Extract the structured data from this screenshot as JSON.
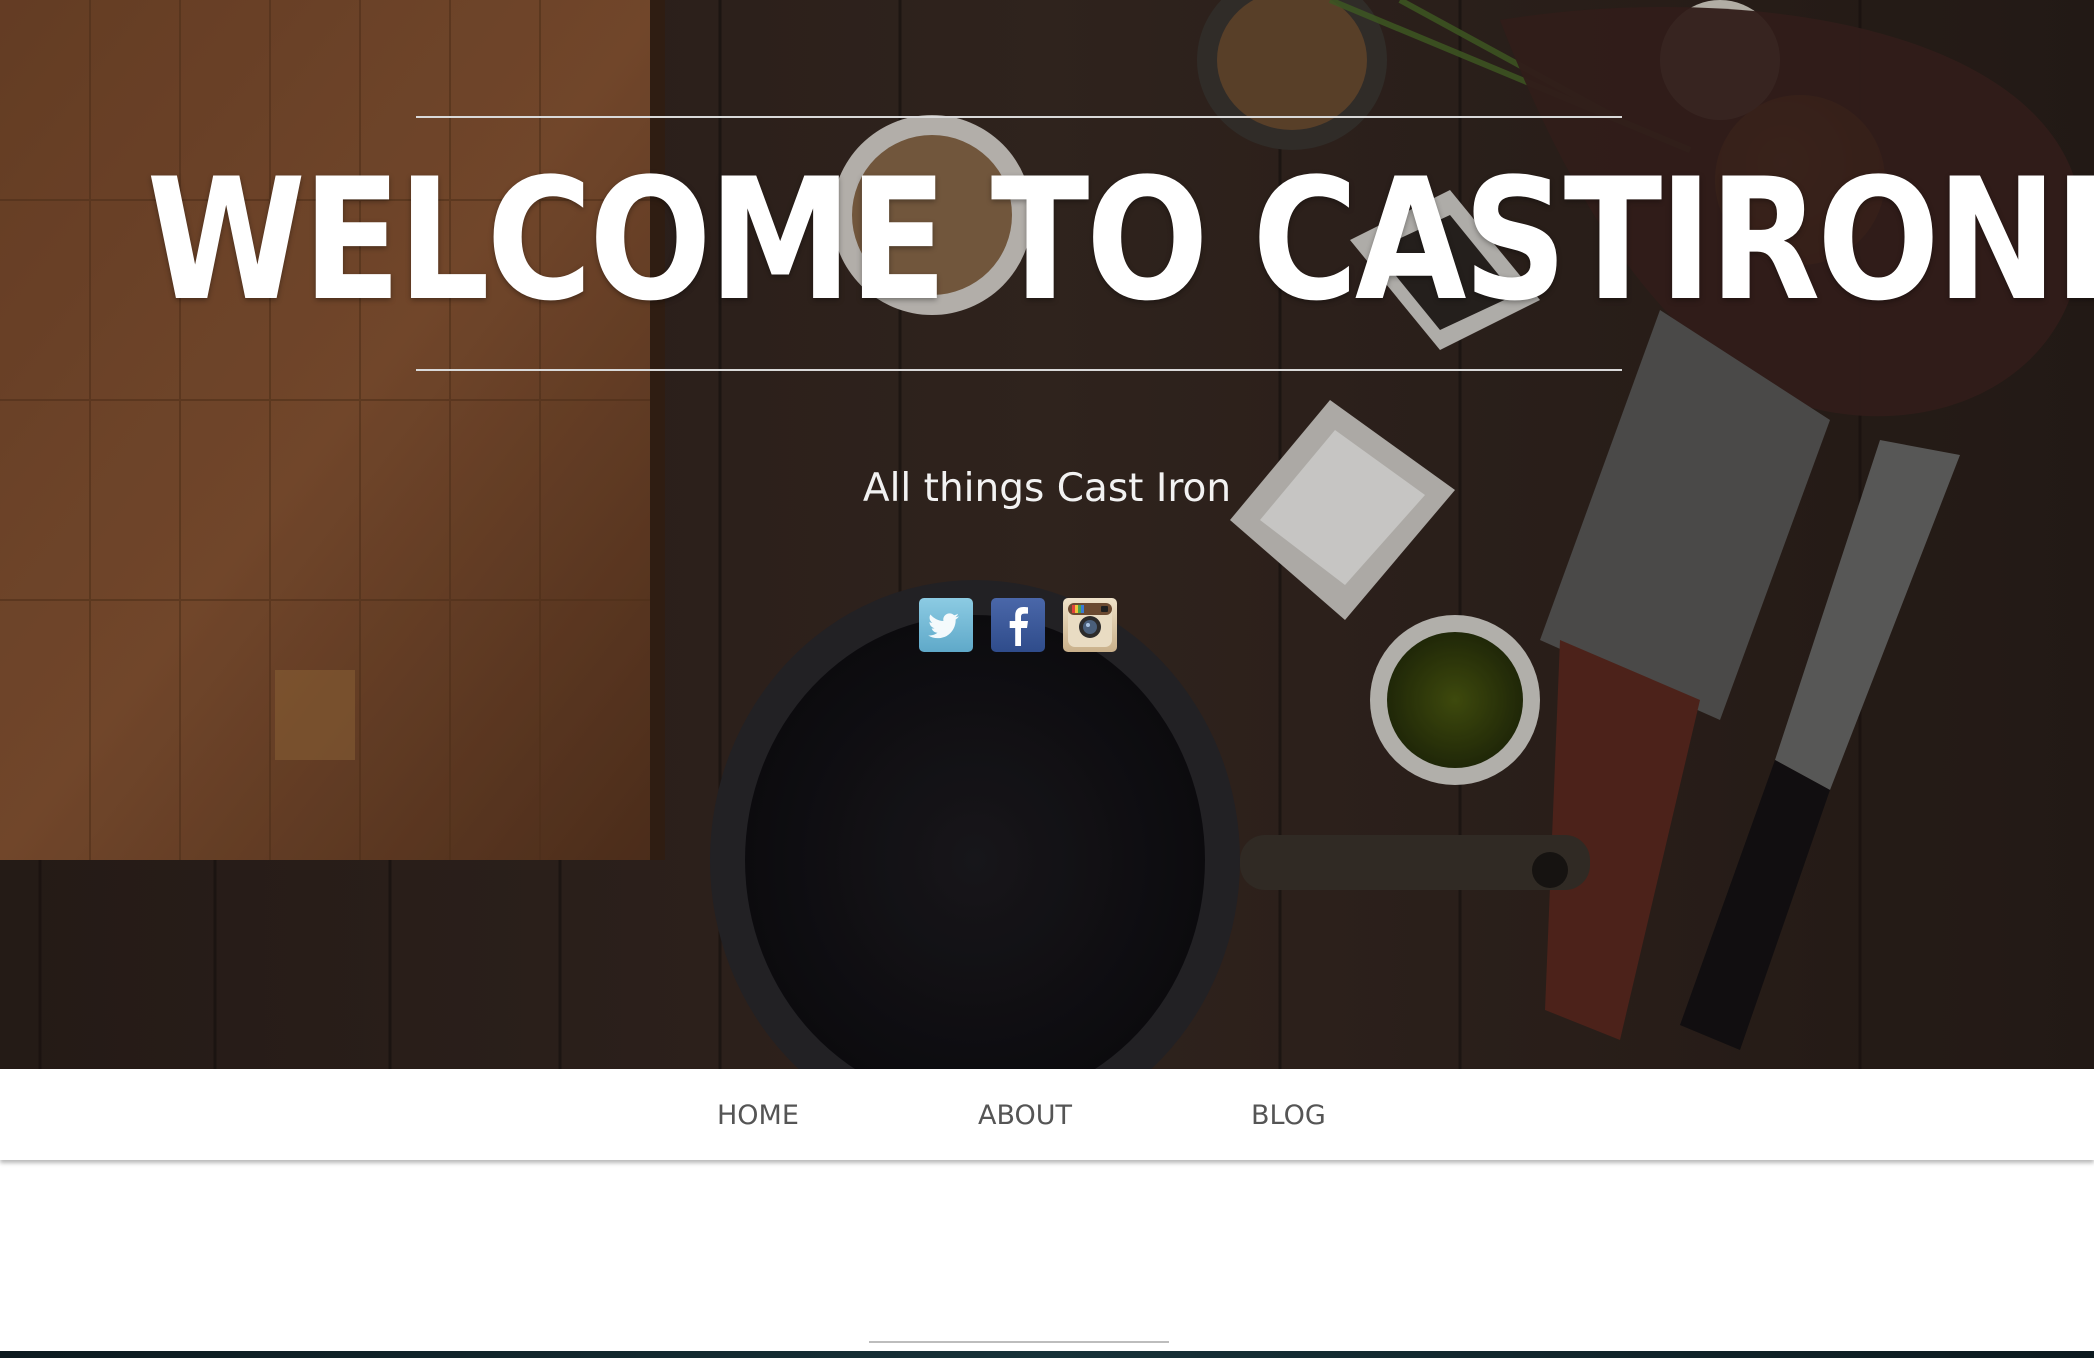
{
  "hero": {
    "title": "WELCOME TO CASTIRONED",
    "subtitle": "All things Cast Iron"
  },
  "social": [
    {
      "name": "twitter",
      "icon": "twitter-icon",
      "color": "#6fb7d6"
    },
    {
      "name": "facebook",
      "icon": "facebook-icon",
      "color": "#3b5998"
    },
    {
      "name": "instagram",
      "icon": "instagram-icon",
      "color": "#c9b08a"
    }
  ],
  "nav": {
    "home": "HOME",
    "about": "ABOUT",
    "blog": "BLOG"
  },
  "colors": {
    "title": "#ffffff",
    "nav_text": "#555555",
    "hero_dark": "#2a201b"
  }
}
